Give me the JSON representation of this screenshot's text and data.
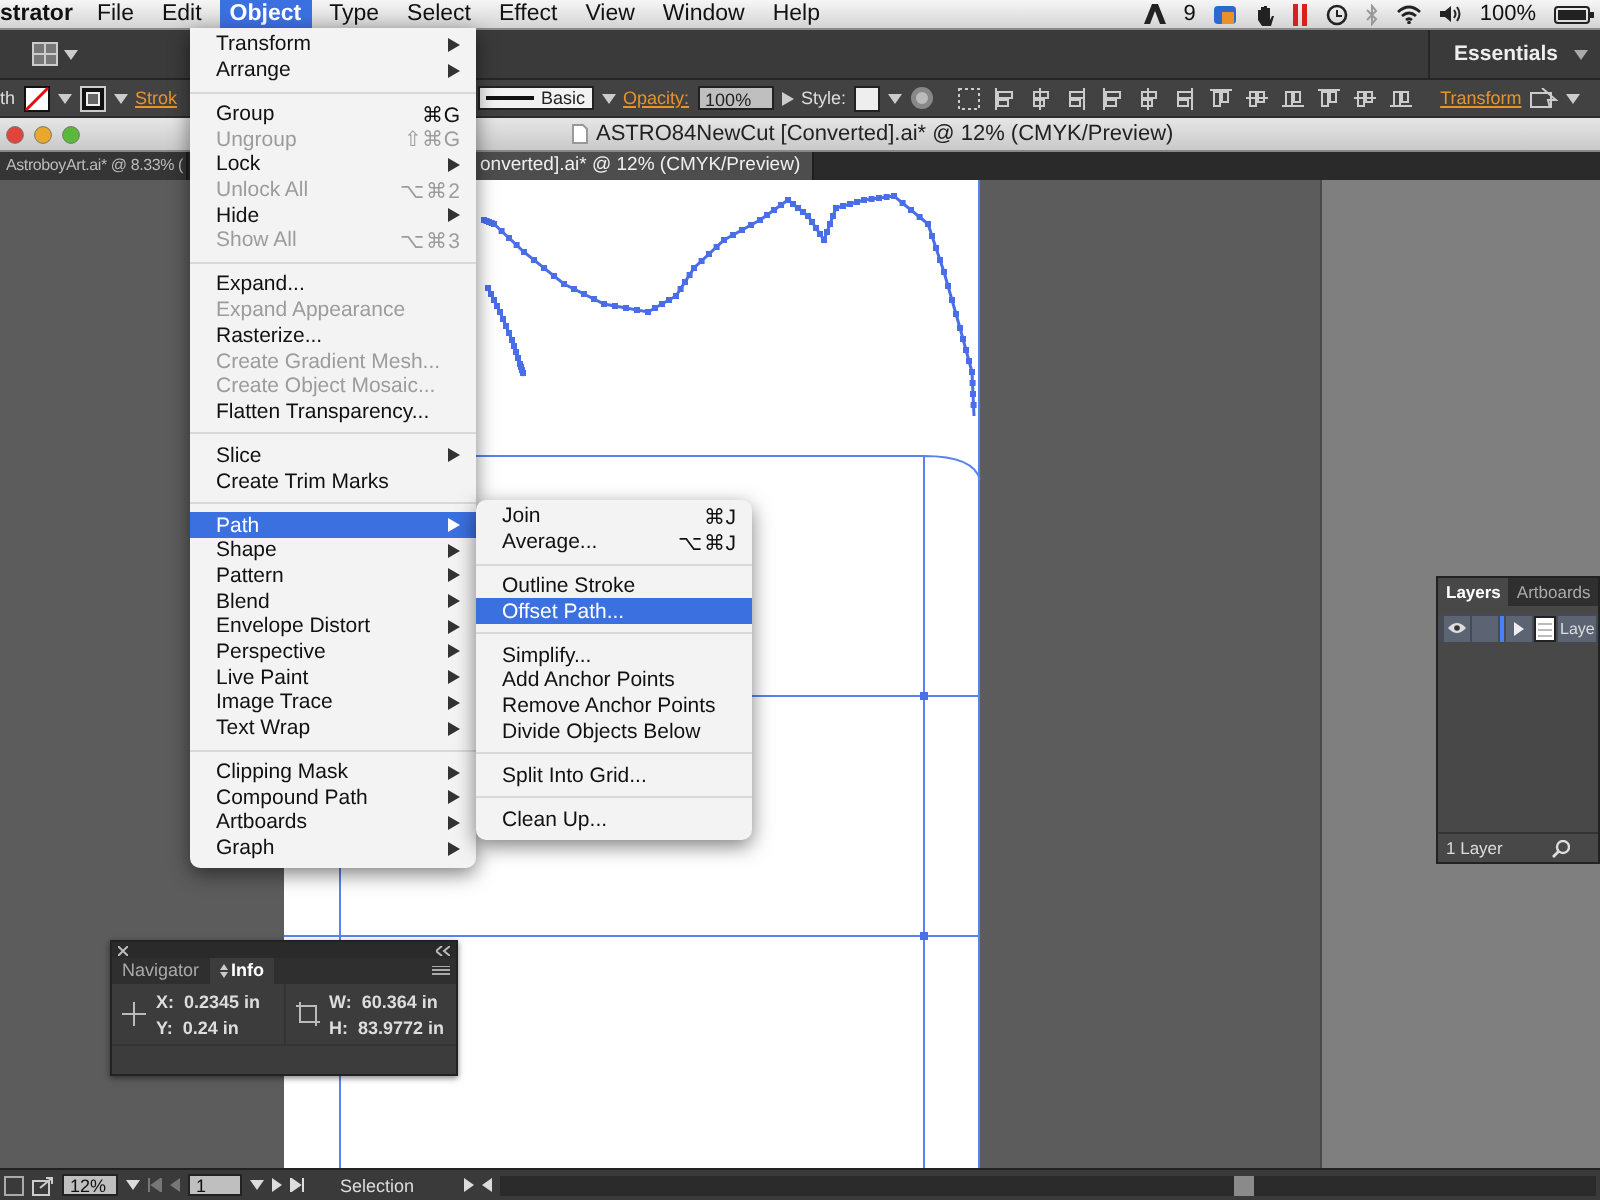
{
  "menubar": {
    "app_name": "strator",
    "menus": [
      {
        "label": "File",
        "selected": false
      },
      {
        "label": "Edit",
        "selected": false
      },
      {
        "label": "Object",
        "selected": true
      },
      {
        "label": "Type",
        "selected": false
      },
      {
        "label": "Select",
        "selected": false
      },
      {
        "label": "Effect",
        "selected": false
      },
      {
        "label": "View",
        "selected": false
      },
      {
        "label": "Window",
        "selected": false
      },
      {
        "label": "Help",
        "selected": false
      }
    ],
    "status_number": "9",
    "battery": "100%"
  },
  "app_bar": {
    "workspace": "Essentials"
  },
  "control_bar": {
    "cut_label": "th",
    "stroke_label": "Strok",
    "profile": "Basic",
    "opacity_label": "Opacity:",
    "opacity_value": "100%",
    "style_label": "Style:",
    "transform_label": "Transform"
  },
  "document": {
    "title": "ASTRO84NewCut [Converted].ai* @ 12% (CMYK/Preview)",
    "tabs": [
      {
        "label": "AstroboyArt.ai* @ 8.33% (",
        "selected": false
      },
      {
        "label": "onverted].ai* @ 12% (CMYK/Preview)",
        "selected": true
      }
    ]
  },
  "object_menu": {
    "items": [
      {
        "kind": "item",
        "label": "Transform",
        "submenu": true,
        "disabled": false,
        "selected": false
      },
      {
        "kind": "item",
        "label": "Arrange",
        "submenu": true,
        "disabled": false,
        "selected": false
      },
      {
        "kind": "separator"
      },
      {
        "kind": "item",
        "label": "Group",
        "shortcut": "⌘G",
        "submenu": false,
        "disabled": false,
        "selected": false
      },
      {
        "kind": "item",
        "label": "Ungroup",
        "shortcut": "⇧⌘G",
        "submenu": false,
        "disabled": true,
        "selected": false
      },
      {
        "kind": "item",
        "label": "Lock",
        "submenu": true,
        "disabled": false,
        "selected": false
      },
      {
        "kind": "item",
        "label": "Unlock All",
        "shortcut": "⌥⌘2",
        "submenu": false,
        "disabled": true,
        "selected": false
      },
      {
        "kind": "item",
        "label": "Hide",
        "submenu": true,
        "disabled": false,
        "selected": false
      },
      {
        "kind": "item",
        "label": "Show All",
        "shortcut": "⌥⌘3",
        "submenu": false,
        "disabled": true,
        "selected": false
      },
      {
        "kind": "separator"
      },
      {
        "kind": "item",
        "label": "Expand...",
        "submenu": false,
        "disabled": false,
        "selected": false
      },
      {
        "kind": "item",
        "label": "Expand Appearance",
        "submenu": false,
        "disabled": true,
        "selected": false
      },
      {
        "kind": "item",
        "label": "Rasterize...",
        "submenu": false,
        "disabled": false,
        "selected": false
      },
      {
        "kind": "item",
        "label": "Create Gradient Mesh...",
        "submenu": false,
        "disabled": true,
        "selected": false
      },
      {
        "kind": "item",
        "label": "Create Object Mosaic...",
        "submenu": false,
        "disabled": true,
        "selected": false
      },
      {
        "kind": "item",
        "label": "Flatten Transparency...",
        "submenu": false,
        "disabled": false,
        "selected": false
      },
      {
        "kind": "separator"
      },
      {
        "kind": "item",
        "label": "Slice",
        "submenu": true,
        "disabled": false,
        "selected": false
      },
      {
        "kind": "item",
        "label": "Create Trim Marks",
        "submenu": false,
        "disabled": false,
        "selected": false
      },
      {
        "kind": "separator"
      },
      {
        "kind": "item",
        "label": "Path",
        "submenu": true,
        "disabled": false,
        "selected": true
      },
      {
        "kind": "item",
        "label": "Shape",
        "submenu": true,
        "disabled": false,
        "selected": false
      },
      {
        "kind": "item",
        "label": "Pattern",
        "submenu": true,
        "disabled": false,
        "selected": false
      },
      {
        "kind": "item",
        "label": "Blend",
        "submenu": true,
        "disabled": false,
        "selected": false
      },
      {
        "kind": "item",
        "label": "Envelope Distort",
        "submenu": true,
        "disabled": false,
        "selected": false
      },
      {
        "kind": "item",
        "label": "Perspective",
        "submenu": true,
        "disabled": false,
        "selected": false
      },
      {
        "kind": "item",
        "label": "Live Paint",
        "submenu": true,
        "disabled": false,
        "selected": false
      },
      {
        "kind": "item",
        "label": "Image Trace",
        "submenu": true,
        "disabled": false,
        "selected": false
      },
      {
        "kind": "item",
        "label": "Text Wrap",
        "submenu": true,
        "disabled": false,
        "selected": false
      },
      {
        "kind": "separator"
      },
      {
        "kind": "item",
        "label": "Clipping Mask",
        "submenu": true,
        "disabled": false,
        "selected": false
      },
      {
        "kind": "item",
        "label": "Compound Path",
        "submenu": true,
        "disabled": false,
        "selected": false
      },
      {
        "kind": "item",
        "label": "Artboards",
        "submenu": true,
        "disabled": false,
        "selected": false
      },
      {
        "kind": "item",
        "label": "Graph",
        "submenu": true,
        "disabled": false,
        "selected": false
      }
    ]
  },
  "path_submenu": {
    "items": [
      {
        "kind": "item",
        "label": "Join",
        "shortcut": "⌘J",
        "submenu": false,
        "disabled": false,
        "selected": false
      },
      {
        "kind": "item",
        "label": "Average...",
        "shortcut": "⌥⌘J",
        "submenu": false,
        "disabled": false,
        "selected": false
      },
      {
        "kind": "separator"
      },
      {
        "kind": "item",
        "label": "Outline Stroke",
        "submenu": false,
        "disabled": false,
        "selected": false
      },
      {
        "kind": "item",
        "label": "Offset Path...",
        "submenu": false,
        "disabled": false,
        "selected": true
      },
      {
        "kind": "separator"
      },
      {
        "kind": "item",
        "label": "Simplify...",
        "submenu": false,
        "disabled": false,
        "selected": false
      },
      {
        "kind": "item",
        "label": "Add Anchor Points",
        "submenu": false,
        "disabled": false,
        "selected": false
      },
      {
        "kind": "item",
        "label": "Remove Anchor Points",
        "submenu": false,
        "disabled": false,
        "selected": false
      },
      {
        "kind": "item",
        "label": "Divide Objects Below",
        "submenu": false,
        "disabled": false,
        "selected": false
      },
      {
        "kind": "separator"
      },
      {
        "kind": "item",
        "label": "Split Into Grid...",
        "submenu": false,
        "disabled": false,
        "selected": false
      },
      {
        "kind": "separator"
      },
      {
        "kind": "item",
        "label": "Clean Up...",
        "submenu": false,
        "disabled": false,
        "selected": false
      }
    ]
  },
  "info_panel": {
    "tabs": [
      {
        "label": "Navigator",
        "selected": false
      },
      {
        "label": "Info",
        "selected": true
      }
    ],
    "position": [
      {
        "label": "X:",
        "value": "0.2345 in"
      },
      {
        "label": "Y:",
        "value": "0.24 in"
      }
    ],
    "size": [
      {
        "label": "W:",
        "value": "60.364 in"
      },
      {
        "label": "H:",
        "value": "83.9772 in"
      }
    ]
  },
  "layers_panel": {
    "tabs": [
      {
        "label": "Layers",
        "selected": true
      },
      {
        "label": "Artboards",
        "selected": false
      }
    ],
    "layers": [
      {
        "name": "Laye",
        "visible": true
      }
    ],
    "footer": "1 Layer"
  },
  "status_bar": {
    "zoom": "12%",
    "page": "1",
    "tool": "Selection"
  }
}
